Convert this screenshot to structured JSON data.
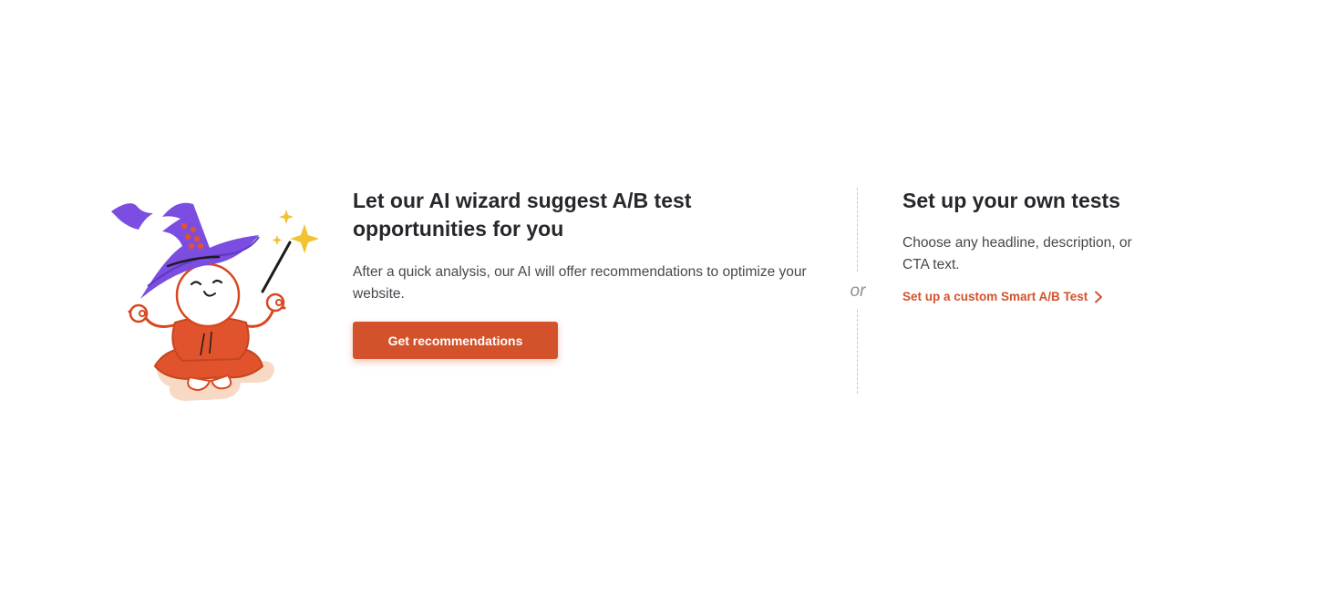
{
  "illustration": {
    "icon": "wizard-illustration-icon",
    "colors": {
      "hat": "#7b4de0",
      "body": "#e0532c",
      "sparkle": "#f2c230",
      "cushion": "#f8d9c4"
    }
  },
  "left_panel": {
    "title": "Let our AI wizard suggest A/B test opportunities for you",
    "description": "After a quick analysis, our AI will offer recommendations to optimize your website.",
    "button_label": "Get recommendations"
  },
  "divider": {
    "label": "or"
  },
  "right_panel": {
    "title": "Set up your own tests",
    "description": "Choose any headline, description, or CTA text.",
    "link_label": "Set up a custom Smart A/B Test",
    "link_icon": "chevron-right-icon"
  },
  "theme": {
    "accent": "#d3522b",
    "text_primary": "#25272b",
    "text_secondary": "#45484d",
    "muted": "#8e9196"
  }
}
